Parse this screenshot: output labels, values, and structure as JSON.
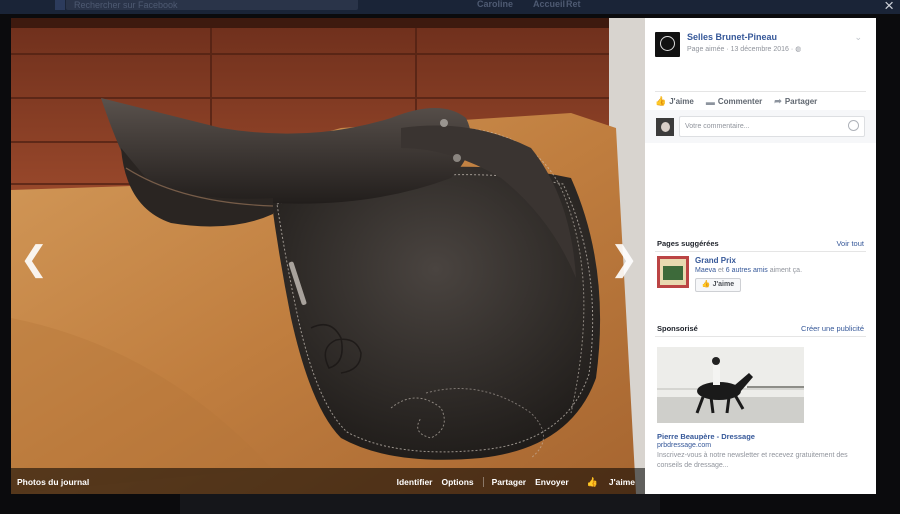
{
  "background": {
    "search_placeholder": "Rechercher sur Facebook",
    "nav_items": [
      "Caroline",
      "Accueil",
      "Ret"
    ]
  },
  "viewer": {
    "close_label": "×",
    "prev_arrow": "❮",
    "next_arrow": "❯",
    "album_title": "Photos du journal",
    "actions": {
      "tag": "Identifier",
      "options": "Options",
      "share": "Partager",
      "send": "Envoyer",
      "like": "J'aime"
    }
  },
  "panel": {
    "page_name": "Selles Brunet-Pineau",
    "page_meta": "Page aimée · 13 décembre 2016 · ",
    "reactions": {
      "like": "J'aime",
      "comment": "Commenter",
      "share": "Partager"
    },
    "comment_placeholder": "Votre commentaire...",
    "suggested": {
      "title": "Pages suggérées",
      "see_all": "Voir tout",
      "name": "Grand Prix",
      "friend1": "Maeva",
      "and": " et ",
      "friend_count": "6 autres amis",
      "liked": " aiment ça.",
      "like_button": "J'aime"
    },
    "sponsored": {
      "title": "Sponsorisé",
      "create_ad": "Créer une publicité",
      "ad_title": "Pierre Beaupère - Dressage",
      "ad_domain": "prbdressage.com",
      "ad_desc": "Inscrivez-vous à notre newsletter et recevez gratuitement des conseils de dressage..."
    }
  },
  "colors": {
    "link": "#365899",
    "muted": "#90949c",
    "leather": "#2b2724",
    "suede": "#c78a4a",
    "wood": "#9a4a2e"
  }
}
